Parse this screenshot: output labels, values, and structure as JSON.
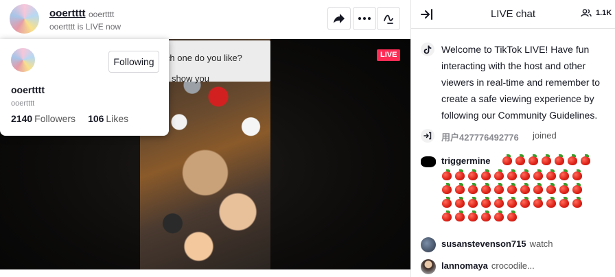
{
  "host": {
    "name": "ooertttt",
    "handle": "ooertttt",
    "status": "ooertttt is LIVE now"
  },
  "toolbar": {
    "share_icon": "share-arrow-icon",
    "more_icon": "more-dots-icon",
    "chat_toggle_icon": "chat-toggle-icon"
  },
  "video": {
    "live_badge": "LIVE",
    "sign_line_1": "ich one do you like?",
    "sign_line_2": "show you"
  },
  "host_card": {
    "name": "ooertttt",
    "handle": "ooertttt",
    "follow_button": "Following",
    "followers_count": "2140",
    "followers_label": "Followers",
    "likes_count": "106",
    "likes_label": "Likes"
  },
  "chat_panel": {
    "title": "LIVE chat",
    "viewer_count": "1.1K",
    "collapse_icon": "collapse-arrow-icon",
    "viewers_icon": "people-icon"
  },
  "messages": {
    "welcome": "Welcome to TikTok LIVE! Have fun interacting with the host and other viewers in real-time and remember to create a safe viewing experience by following our Community Guidelines.",
    "joined_user": "用户427776492776",
    "joined_label": "joined",
    "trigger_user": "triggermine",
    "trigger_apple_count": 46,
    "susan_user": "susanstevenson715",
    "susan_msg": "watch",
    "lanno_user": "lannomaya",
    "lanno_msg": "crocodile..."
  },
  "colors": {
    "live_badge": "#fe2c55",
    "text_primary": "#161823",
    "text_secondary": "#8a8b91"
  }
}
